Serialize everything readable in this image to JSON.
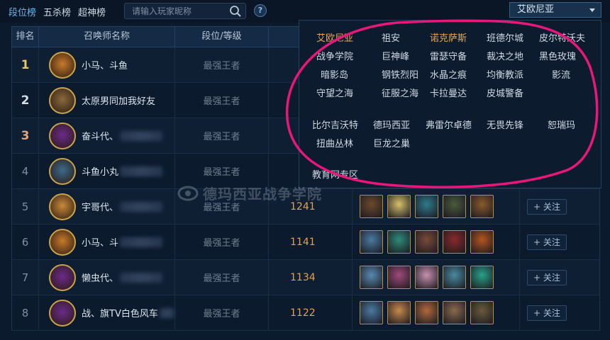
{
  "tabs": [
    {
      "label": "段位榜",
      "active": true
    },
    {
      "label": "五杀榜",
      "active": false
    },
    {
      "label": "超神榜",
      "active": false
    }
  ],
  "search": {
    "placeholder": "请输入玩家昵称"
  },
  "help": {
    "label": "?"
  },
  "region_select": {
    "value": "艾欧尼亚"
  },
  "table": {
    "headers": {
      "rank": "排名",
      "name": "召唤师名称",
      "tier": "段位/等级"
    },
    "follow_label": "+ 关注",
    "rows": [
      {
        "rank": "1",
        "name": "小马、斗鱼",
        "tier": "最强王者",
        "score": "",
        "avatar_color": "#c77a2a",
        "medal": "gold"
      },
      {
        "rank": "2",
        "name": "太原男同加我好友",
        "tier": "最强王者",
        "score": "",
        "avatar_color": "#8a6a3d",
        "medal": "silver"
      },
      {
        "rank": "3",
        "name": "奋斗代、",
        "tier": "最强王者",
        "score": "",
        "avatar_color": "#6a2a8a",
        "medal": "bronze"
      },
      {
        "rank": "4",
        "name": "斗鱼小丸",
        "tier": "最强王者",
        "score": "",
        "avatar_color": "#3a6a8a",
        "medal": "none"
      },
      {
        "rank": "5",
        "name": "宇哥代、",
        "tier": "最强王者",
        "score": "1241",
        "avatar_color": "#c9893a",
        "medal": "none"
      },
      {
        "rank": "6",
        "name": "小马、斗",
        "tier": "最强王者",
        "score": "1141",
        "avatar_color": "#c77a2a",
        "medal": "none"
      },
      {
        "rank": "7",
        "name": "懒虫代、",
        "tier": "最强王者",
        "score": "1134",
        "avatar_color": "#6a2a8a",
        "medal": "none"
      },
      {
        "rank": "8",
        "name": "战、旗TV白色风车",
        "tier": "最强王者",
        "score": "1122",
        "avatar_color": "#6a2a8a",
        "medal": "none"
      }
    ]
  },
  "region_panel": {
    "rows": [
      [
        "艾欧尼亚",
        "祖安",
        "诺克萨斯",
        "班德尔城",
        "皮尔特沃夫"
      ],
      [
        "战争学院",
        "巨神峰",
        "雷瑟守备",
        "裁决之地",
        "黑色玫瑰"
      ],
      [
        "暗影岛",
        "钢铁烈阳",
        "水晶之痕",
        "均衡教派",
        "影流"
      ],
      [
        "守望之海",
        "征服之海",
        "卡拉曼达",
        "皮城警备"
      ],
      [
        "比尔吉沃特",
        "德玛西亚",
        "弗雷尔卓德",
        "无畏先锋",
        "恕瑞玛"
      ],
      [
        "扭曲丛林",
        "巨龙之巢"
      ],
      [
        "教育网专区"
      ]
    ],
    "highlighted": [
      "艾欧尼亚",
      "诺克萨斯"
    ]
  },
  "watermark": {
    "text": "德玛西亚战争学院"
  },
  "colors": {
    "accent": "#6fb5ee",
    "score": "#e6a24a",
    "annotation": "#e8177a",
    "background": "#0b1a2c"
  }
}
